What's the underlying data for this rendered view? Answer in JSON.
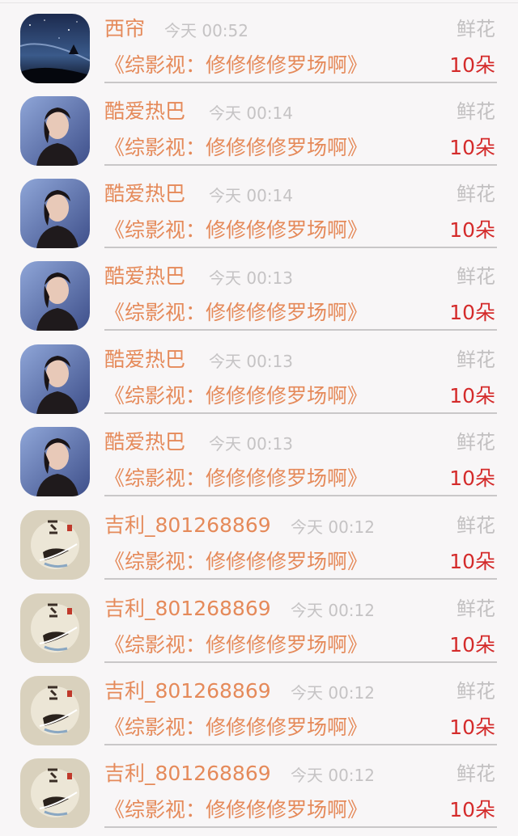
{
  "rows": [
    {
      "avatar": "night-sky-avatar",
      "name": "西帘",
      "time": "今天 00:52",
      "gift_type": "鲜花",
      "work": "《综影视：修修修修罗场啊》",
      "count": "10朵"
    },
    {
      "avatar": "woman-portrait-avatar",
      "name": "酷爱热巴",
      "time": "今天 00:14",
      "gift_type": "鲜花",
      "work": "《综影视：修修修修罗场啊》",
      "count": "10朵"
    },
    {
      "avatar": "woman-portrait-avatar",
      "name": "酷爱热巴",
      "time": "今天 00:14",
      "gift_type": "鲜花",
      "work": "《综影视：修修修修罗场啊》",
      "count": "10朵"
    },
    {
      "avatar": "woman-portrait-avatar",
      "name": "酷爱热巴",
      "time": "今天 00:13",
      "gift_type": "鲜花",
      "work": "《综影视：修修修修罗场啊》",
      "count": "10朵"
    },
    {
      "avatar": "woman-portrait-avatar",
      "name": "酷爱热巴",
      "time": "今天 00:13",
      "gift_type": "鲜花",
      "work": "《综影视：修修修修罗场啊》",
      "count": "10朵"
    },
    {
      "avatar": "woman-portrait-avatar",
      "name": "酷爱热巴",
      "time": "今天 00:13",
      "gift_type": "鲜花",
      "work": "《综影视：修修修修罗场啊》",
      "count": "10朵"
    },
    {
      "avatar": "calligraphy-fan-avatar",
      "name": "吉利_801268869",
      "time": "今天 00:12",
      "gift_type": "鲜花",
      "work": "《综影视：修修修修罗场啊》",
      "count": "10朵"
    },
    {
      "avatar": "calligraphy-fan-avatar",
      "name": "吉利_801268869",
      "time": "今天 00:12",
      "gift_type": "鲜花",
      "work": "《综影视：修修修修罗场啊》",
      "count": "10朵"
    },
    {
      "avatar": "calligraphy-fan-avatar",
      "name": "吉利_801268869",
      "time": "今天 00:12",
      "gift_type": "鲜花",
      "work": "《综影视：修修修修罗场啊》",
      "count": "10朵"
    },
    {
      "avatar": "calligraphy-fan-avatar",
      "name": "吉利_801268869",
      "time": "今天 00:12",
      "gift_type": "鲜花",
      "work": "《综影视：修修修修罗场啊》",
      "count": "10朵"
    }
  ],
  "colors": {
    "name": "#e58a5a",
    "time": "#c5c3c4",
    "gift_type": "#c2c0c1",
    "count": "#d42b2b",
    "divider": "#c9c7c8",
    "background": "#f8f6f7"
  }
}
